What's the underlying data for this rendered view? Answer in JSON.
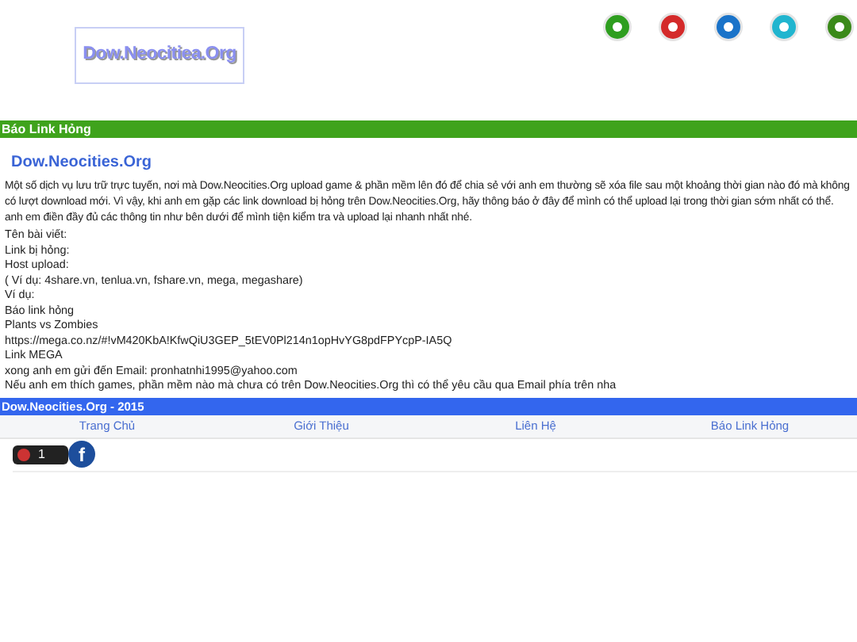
{
  "logo": {
    "text": "Dow.Neocitiea.Org"
  },
  "social_icons": [
    {
      "color": "#2e9e1f"
    },
    {
      "color": "#d42a2a"
    },
    {
      "color": "#1a73c9"
    },
    {
      "color": "#21b5cf"
    },
    {
      "color": "#3b8a1a"
    }
  ],
  "section_bar": {
    "title": "Báo Link Hỏng"
  },
  "post": {
    "title": "Dow.Neocities.Org",
    "paragraph": "Một số dịch vụ lưu trữ trực tuyến, nơi mà Dow.Neocities.Org upload game & phần mềm lên đó để chia sẻ với anh em thường sẽ xóa file sau một khoảng thời gian nào đó mà không có lượt download mới. Vì vậy, khi anh em gặp các link download bị hỏng trên Dow.Neocities.Org, hãy thông báo ở đây để mình có thể upload lại trong thời gian sớm nhất có thể. anh em điền đầy đủ các thông tin như bên dưới để mình tiện kiểm tra và upload lại nhanh nhất nhé.",
    "lines": [
      "Tên bài viết:",
      "Link bị hỏng:",
      "Host upload:",
      "( Ví dụ: 4share.vn, tenlua.vn, fshare.vn, mega, megashare)",
      "Ví dụ:",
      "Báo link hỏng",
      "Plants vs Zombies",
      "https://mega.co.nz/#!vM420KbA!KfwQiU3GEP_5tEV0Pl214n1opHvYG8pdFPYcpP-IA5Q",
      "Link MEGA",
      "xong anh em gửi đến Email: pronhatnhi1995@yahoo.com",
      "Nếu anh em thích games, phần mềm nào mà chưa có trên Dow.Neocities.Org thì có thể yêu cầu qua Email phía trên nha"
    ]
  },
  "footer_bar": {
    "title": "Dow.Neocities.Org - 2015"
  },
  "nav": [
    {
      "label": "Trang Chủ"
    },
    {
      "label": "Giới Thiệu"
    },
    {
      "label": "Liên Hệ"
    },
    {
      "label": "Báo Link Hỏng"
    }
  ],
  "share": {
    "count": "1",
    "facebook": "f"
  }
}
